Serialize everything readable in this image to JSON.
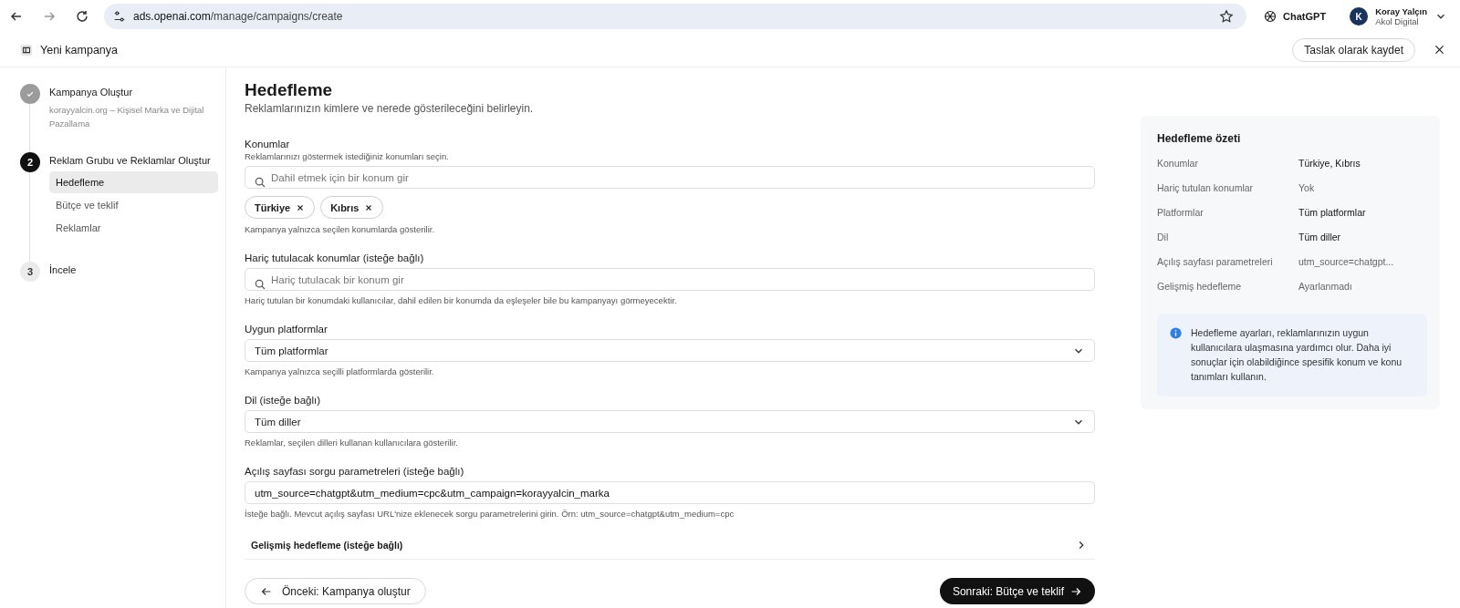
{
  "browser": {
    "url_host": "ads.openai.com",
    "url_path": "/manage/campaigns/create",
    "bookmarked": false,
    "extension_label": "ChatGPT",
    "profile": {
      "initial": "K",
      "name": "Koray Yalçın",
      "org": "Akol Digital"
    }
  },
  "header": {
    "title": "Yeni kampanya",
    "save_draft": "Taslak olarak kaydet"
  },
  "steps": [
    {
      "done": true,
      "current": false,
      "title": "Kampanya Oluştur",
      "subtitle": "korayyalcin.org – Kişisel Marka ve Dijital Pazallama"
    },
    {
      "number": "2",
      "done": false,
      "current": true,
      "title": "Reklam Grubu ve Reklamlar Oluştur",
      "items": [
        {
          "label": "Hedefleme",
          "selected": true
        },
        {
          "label": "Bütçe ve teklif",
          "selected": false
        },
        {
          "label": "Reklamlar",
          "selected": false
        }
      ]
    },
    {
      "number": "3",
      "done": false,
      "current": false,
      "title": "İncele"
    }
  ],
  "page": {
    "title": "Hedefleme",
    "subtitle": "Reklamlarınızın kimlere ve nerede gösterileceğini belirleyin."
  },
  "fields": [
    {
      "kind": "search",
      "label": "Konumlar",
      "description": "Reklamlarınızı göstermek istediğiniz konumları seçin.",
      "placeholder": "Dahil etmek için bir konum gir",
      "chips": [
        "Türkiye",
        "Kıbrıs"
      ],
      "help": "Kampanya yalnızca seçilen konumlarda gösterilir."
    },
    {
      "kind": "search",
      "label": "Hariç tutulacak konumlar (isteğe bağlı)",
      "placeholder": "Hariç tutulacak bir konum gir",
      "help": "Hariç tutulan bir konumdaki kullanıcılar, dahil edilen bir konumda da eşleşeler bile bu kampanyayı görmeyecektir."
    },
    {
      "kind": "select",
      "label": "Uygun platformlar",
      "value": "Tüm platformlar",
      "help": "Kampanya yalnızca seçilli platformlarda gösterilir."
    },
    {
      "kind": "select",
      "label": "Dil (isteğe bağlı)",
      "value": "Tüm diller",
      "help": "Reklamlar, seçilen dilleri kullanan kullanıcılara gösterilir."
    },
    {
      "kind": "text",
      "label": "Açılış sayfası sorgu parametreleri (isteğe bağlı)",
      "value": "utm_source=chatgpt&utm_medium=cpc&utm_campaign=korayyalcin_marka",
      "help": "İsteğe bağlı. Mevcut açılış sayfası URL'nize eklenecek sorgu parametrelerini girin. Örn: utm_source=chatgpt&utm_medium=cpc"
    },
    {
      "kind": "collapsible",
      "label": "Gelişmiş hedefleme (isteğe bağlı)",
      "expanded": false
    }
  ],
  "footer": {
    "back": "Önceki: Kampanya oluştur",
    "next": "Sonraki: Bütçe ve teklif"
  },
  "summary": {
    "title": "Hedefleme özeti",
    "rows": [
      {
        "label": "Konumlar",
        "value": "Türkiye, Kıbrıs",
        "emphasized": true
      },
      {
        "label": "Hariç tutulan konumlar",
        "value": "Yok",
        "emphasized": false
      },
      {
        "label": "Platformlar",
        "value": "Tüm platformlar",
        "emphasized": true
      },
      {
        "label": "Dil",
        "value": "Tüm diller",
        "emphasized": true
      },
      {
        "label": "Açılış sayfası parametreleri",
        "value": "utm_source=chatgpt...",
        "emphasized": false
      },
      {
        "label": "Gelişmiş hedefleme",
        "value": "Ayarlanmadı",
        "emphasized": false
      }
    ],
    "info": "Hedefleme ayarları, reklamlarınızın uygun kullanıcılara ulaşmasına yardımcı olur. Daha iyi sonuçlar için olabildiğince spesifik konum ve konu tanımları kullanın."
  }
}
